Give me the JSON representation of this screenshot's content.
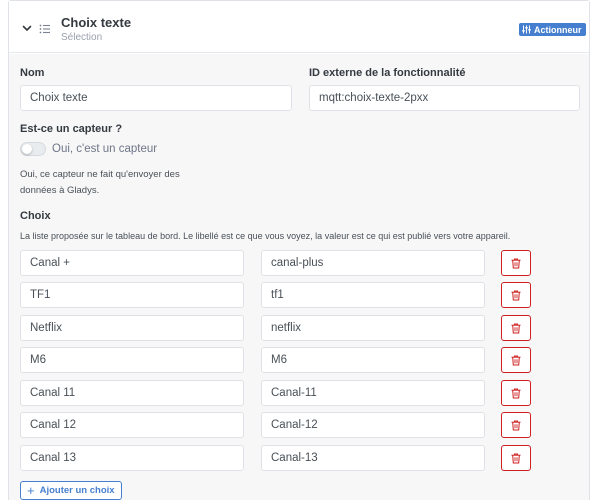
{
  "header": {
    "title": "Choix texte",
    "subtitle": "Sélection",
    "badge": "Actionneur",
    "accent_color": "#467fcf"
  },
  "form": {
    "name_label": "Nom",
    "name_value": "Choix texte",
    "external_id_label": "ID externe de la fonctionnalité",
    "external_id_value": "mqtt:choix-texte-2pxx",
    "sensor_question": "Est-ce un capteur ?",
    "sensor_toggle_label": "Oui, c'est un capteur",
    "sensor_toggle_on": false,
    "sensor_help": "Oui, ce capteur ne fait qu'envoyer des données à Gladys."
  },
  "choices": {
    "title": "Choix",
    "description": "La liste proposée sur le tableau de bord. Le libellé est ce que vous voyez, la valeur est ce qui est publié vers votre appareil.",
    "rows": [
      {
        "label": "Canal +",
        "value": "canal-plus"
      },
      {
        "label": "TF1",
        "value": "tf1"
      },
      {
        "label": "Netflix",
        "value": "netflix"
      },
      {
        "label": "M6",
        "value": "M6"
      },
      {
        "label": "Canal 11",
        "value": "Canal-11"
      },
      {
        "label": "Canal 12",
        "value": "Canal-12"
      },
      {
        "label": "Canal 13",
        "value": "Canal-13"
      }
    ],
    "add_button": "Ajouter un choix",
    "delete_color": "#cd201f"
  },
  "icons": {
    "collapse": "chevron-down-icon",
    "list": "list-icon",
    "actuator": "actuator-icon",
    "delete": "trash-icon",
    "add": "plus-icon"
  }
}
